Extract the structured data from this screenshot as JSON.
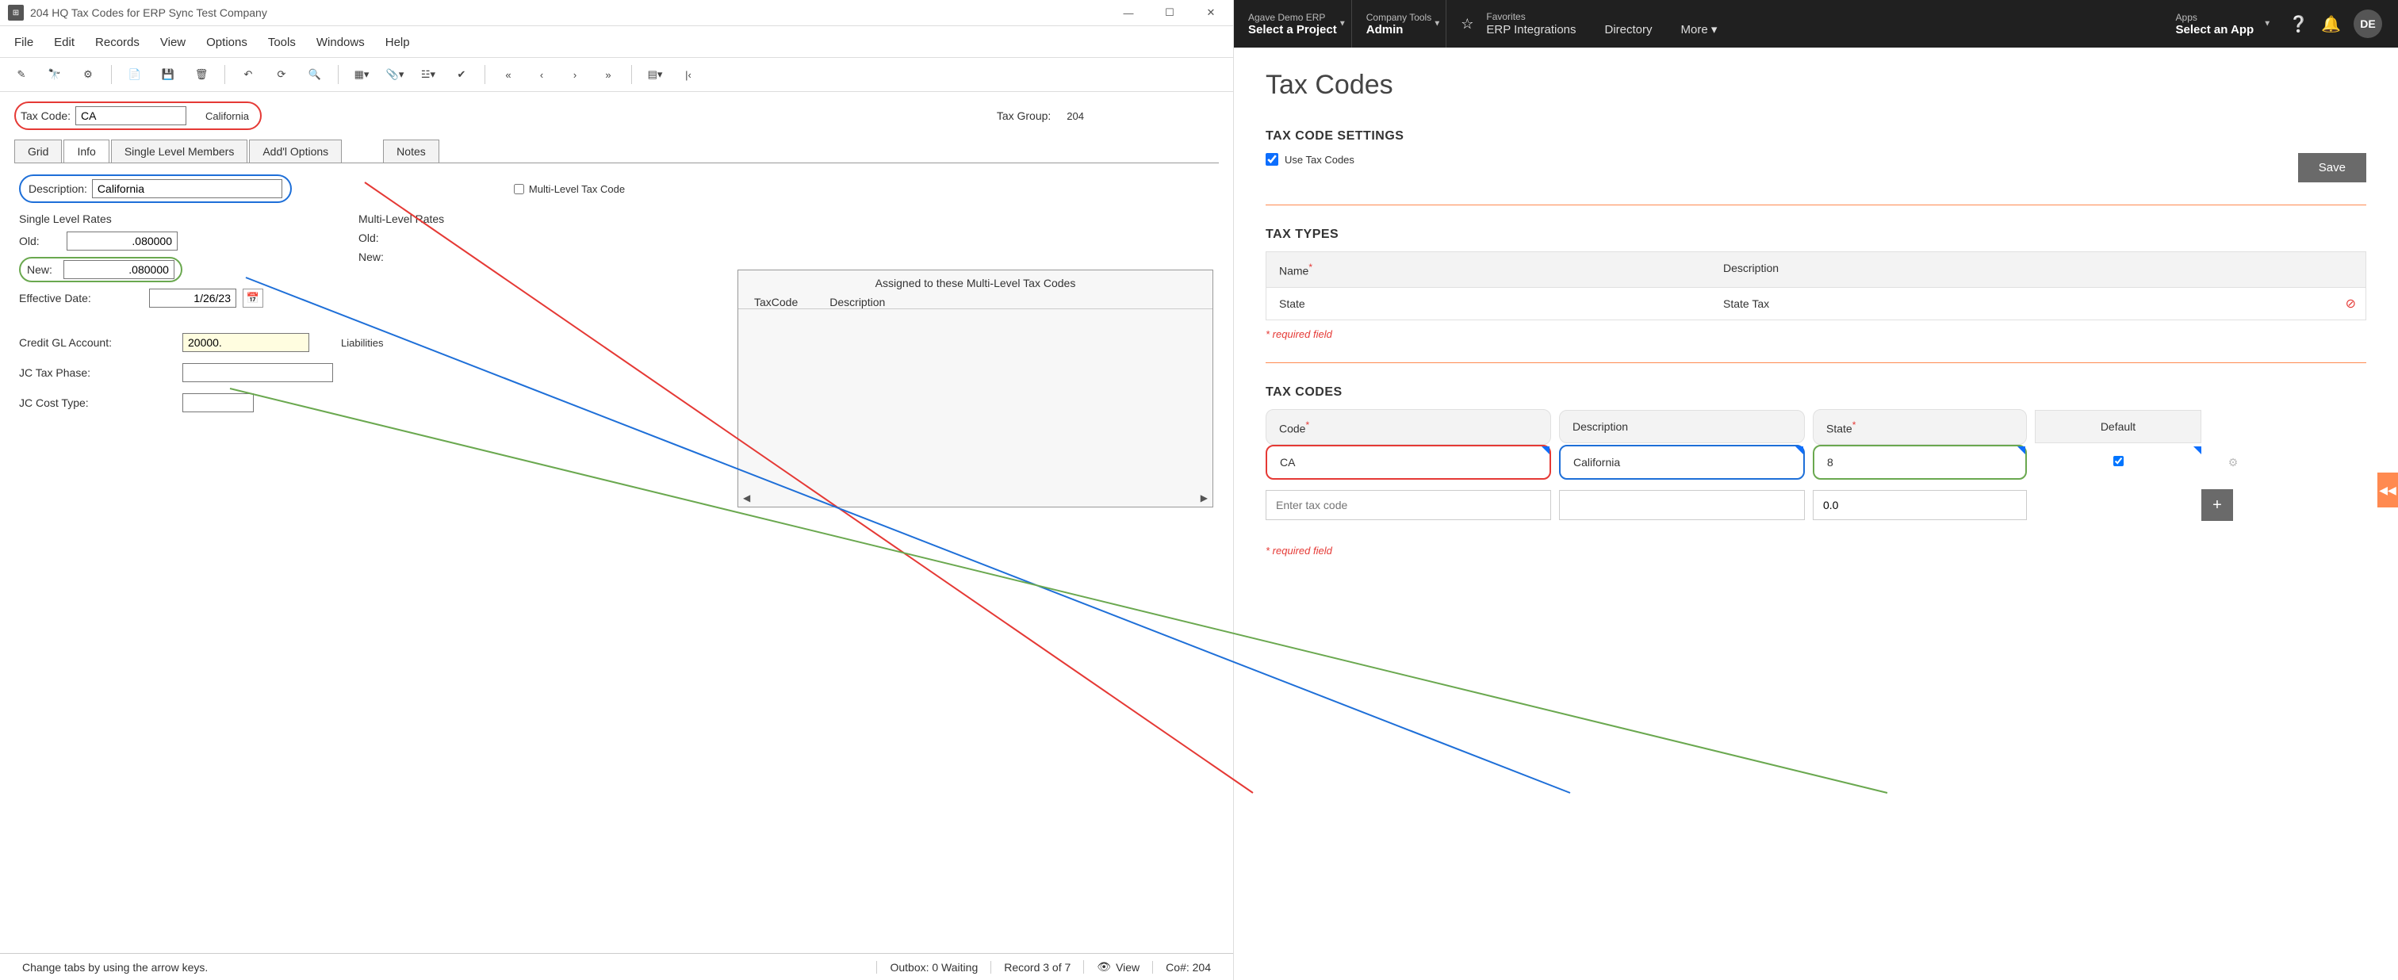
{
  "left": {
    "title": "204 HQ Tax Codes for ERP Sync Test Company",
    "menubar": [
      "File",
      "Edit",
      "Records",
      "View",
      "Options",
      "Tools",
      "Windows",
      "Help"
    ],
    "tax_code": {
      "label": "Tax Code:",
      "value": "CA",
      "name": "California"
    },
    "tax_group": {
      "label": "Tax Group:",
      "value": "204"
    },
    "tabs": {
      "grid": "Grid",
      "info": "Info",
      "single": "Single Level Members",
      "addl": "Add'l Options",
      "notes": "Notes"
    },
    "description": {
      "label": "Description:",
      "value": "California"
    },
    "multi_level_cb": "Multi-Level Tax Code",
    "single_rates": {
      "title": "Single Level Rates",
      "old": {
        "label": "Old:",
        "value": ".080000"
      },
      "new": {
        "label": "New:",
        "value": ".080000"
      },
      "eff": {
        "label": "Effective Date:",
        "value": "1/26/23"
      }
    },
    "multi_rates": {
      "title": "Multi-Level Rates",
      "old": "Old:",
      "new": "New:"
    },
    "gl": {
      "label": "Credit GL Account:",
      "value": "20000.",
      "extra": "Liabilities"
    },
    "jc_phase": "JC Tax Phase:",
    "jc_cost": "JC Cost Type:",
    "multi_panel": {
      "title": "Assigned to these Multi-Level Tax Codes",
      "c1": "TaxCode",
      "c2": "Description"
    },
    "statusbar": {
      "hint": "Change tabs by using the arrow keys.",
      "outbox": "Outbox: 0 Waiting",
      "record": "Record 3 of 7",
      "view": "View",
      "co": "Co#: 204"
    }
  },
  "right": {
    "nav": {
      "project": {
        "small": "Agave Demo ERP",
        "big": "Select a Project"
      },
      "company": {
        "small": "Company Tools",
        "big": "Admin"
      },
      "fav": {
        "small": "Favorites",
        "links": [
          "ERP Integrations",
          "Directory",
          "More"
        ]
      },
      "apps": {
        "small": "Apps",
        "big": "Select an App"
      },
      "avatar": "DE"
    },
    "page_title": "Tax Codes",
    "settings": {
      "title": "TAX CODE SETTINGS",
      "use_label": "Use Tax Codes",
      "save": "Save"
    },
    "types": {
      "title": "TAX TYPES",
      "cols": {
        "name": "Name",
        "desc": "Description"
      },
      "row": {
        "name": "State",
        "desc": "State Tax"
      },
      "req": "* required field"
    },
    "codes": {
      "title": "TAX CODES",
      "cols": {
        "code": "Code",
        "desc": "Description",
        "state": "State",
        "default": "Default"
      },
      "row": {
        "code": "CA",
        "desc": "California",
        "state": "8"
      },
      "input": {
        "placeholder": "Enter tax code",
        "state_default": "0.0"
      },
      "req": "* required field"
    }
  }
}
